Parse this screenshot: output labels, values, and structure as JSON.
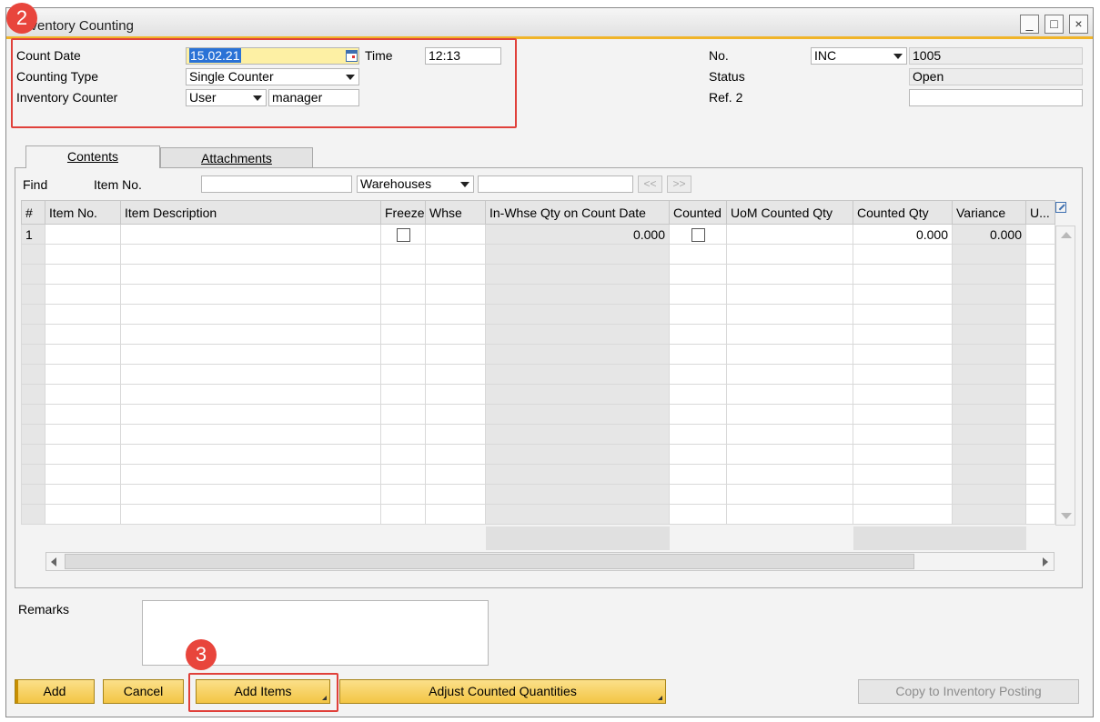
{
  "window": {
    "title": "Inventory Counting",
    "buttons": {
      "minimize": "_",
      "maximize": "□",
      "close": "×"
    }
  },
  "header": {
    "count_date_label": "Count Date",
    "count_date_value": "15.02.21",
    "time_label": "Time",
    "time_value": "12:13",
    "counting_type_label": "Counting Type",
    "counting_type_value": "Single Counter",
    "inventory_counter_label": "Inventory Counter",
    "inventory_counter_type": "User",
    "inventory_counter_value": "manager",
    "no_label": "No.",
    "no_series": "INC",
    "no_value": "1005",
    "status_label": "Status",
    "status_value": "Open",
    "ref2_label": "Ref. 2",
    "ref2_value": ""
  },
  "annotations": {
    "badge_1": "2",
    "badge_2": "3"
  },
  "tabs": [
    {
      "label": "Contents",
      "active": true
    },
    {
      "label": "Attachments",
      "active": false
    }
  ],
  "find_bar": {
    "find_label": "Find",
    "item_no_label": "Item No.",
    "item_no_value": "",
    "warehouses_value": "Warehouses",
    "warehouses_input": "",
    "prev_label": "<<",
    "next_label": ">>"
  },
  "grid": {
    "columns": [
      "#",
      "Item No.",
      "Item Description",
      "Freeze",
      "Whse",
      "In-Whse Qty on Count Date",
      "Counted",
      "UoM Counted Qty",
      "Counted Qty",
      "Variance",
      "U..."
    ],
    "rows": [
      {
        "num": "1",
        "item_no": "",
        "description": "",
        "whse": "",
        "in_whse_qty": "0.000",
        "uom_counted_qty": "",
        "counted_qty": "0.000",
        "variance": "0.000"
      }
    ]
  },
  "remarks": {
    "label": "Remarks",
    "value": ""
  },
  "buttons": {
    "add": "Add",
    "cancel": "Cancel",
    "add_items": "Add Items",
    "adjust_counted_quantities": "Adjust Counted Quantities",
    "copy_to_inventory_posting": "Copy to Inventory Posting"
  },
  "colors": {
    "accent": "#f0b429",
    "annotation": "#e8453c",
    "button": "#f3c544"
  }
}
